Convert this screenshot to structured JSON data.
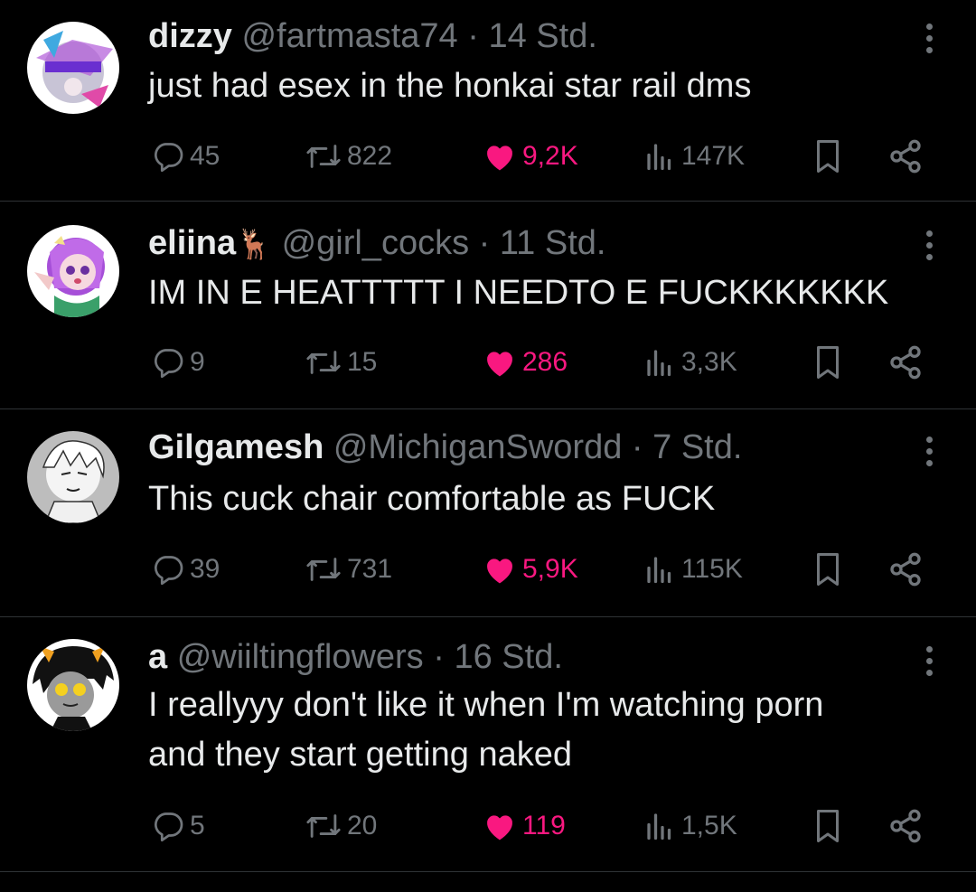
{
  "tweets": [
    {
      "name": "dizzy",
      "name_suffix": "",
      "handle": "@fartmasta74",
      "time": "14 Std.",
      "text_lines": [
        "just had esex in the honkai star rail dms"
      ],
      "replies": "45",
      "reposts": "822",
      "likes": "9,2K",
      "views": "147K"
    },
    {
      "name": "eliina",
      "name_suffix": "🦌",
      "handle": "@girl_cocks",
      "time": "11 Std.",
      "text_lines": [
        "IM IN E HEATTTTT  I NEEDTO E FUCKKKKKKK"
      ],
      "replies": "9",
      "reposts": "15",
      "likes": "286",
      "views": "3,3K"
    },
    {
      "name": "Gilgamesh",
      "name_suffix": "",
      "handle": "@MichiganSwordd",
      "time": "7 Std.",
      "text_lines": [
        "This cuck chair comfortable as FUCK"
      ],
      "replies": "39",
      "reposts": "731",
      "likes": "5,9K",
      "views": "115K"
    },
    {
      "name": "a",
      "name_suffix": "",
      "handle": "@wiiltingflowers",
      "time": "16 Std.",
      "text_lines": [
        "I reallyyy don't like it when I'm watching porn",
        "and they start getting naked"
      ],
      "replies": "5",
      "reposts": "20",
      "likes": "119",
      "views": "1,5K"
    }
  ],
  "separator": "·",
  "colors": {
    "background": "#000000",
    "text": "#e7e9ea",
    "muted": "#71767b",
    "like": "#f91880",
    "divider": "#2f3336"
  },
  "icons": [
    "reply-icon",
    "repost-icon",
    "heart-icon",
    "views-icon",
    "bookmark-icon",
    "share-icon",
    "more-icon"
  ]
}
